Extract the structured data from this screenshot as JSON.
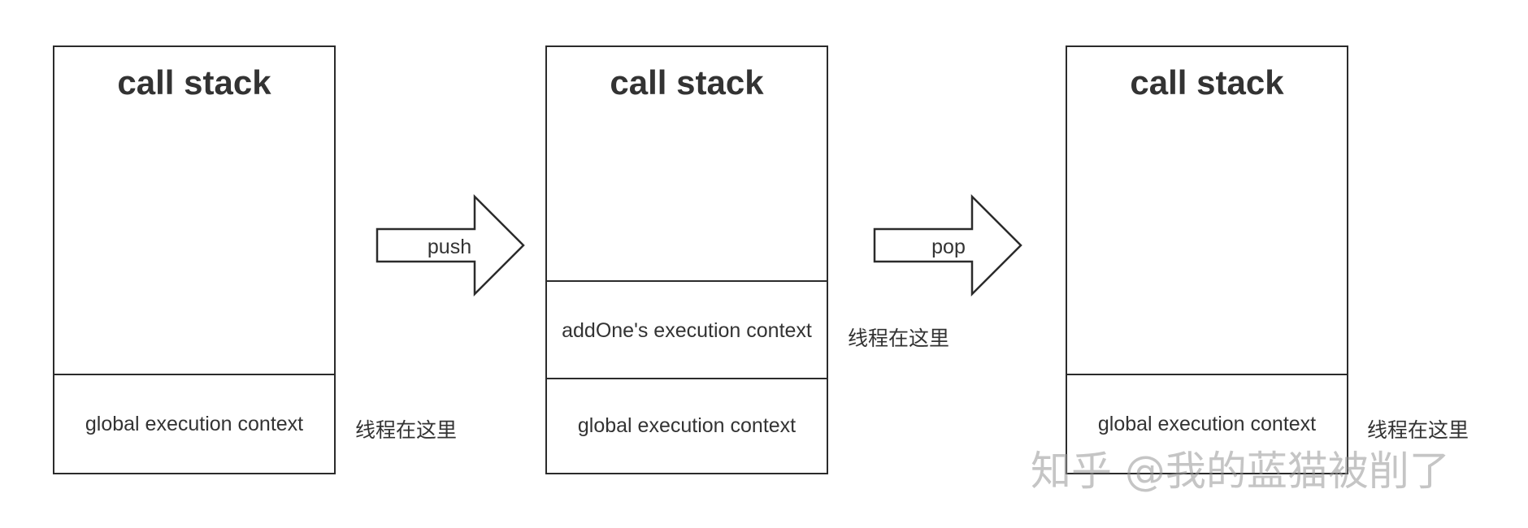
{
  "stacks": [
    {
      "title": "call stack",
      "frames": [
        "global execution context"
      ],
      "thread_label": "线程在这里"
    },
    {
      "title": "call stack",
      "frames": [
        "addOne's execution context",
        "global execution context"
      ],
      "thread_label": "线程在这里"
    },
    {
      "title": "call stack",
      "frames": [
        "global execution context"
      ],
      "thread_label": "线程在这里"
    }
  ],
  "arrows": [
    {
      "label": "push"
    },
    {
      "label": "pop"
    }
  ],
  "watermark": "知乎 @我的蓝猫被削了",
  "colors": {
    "stroke": "#2b2b2b",
    "text": "#333333",
    "background": "#ffffff",
    "watermark": "#969696"
  }
}
